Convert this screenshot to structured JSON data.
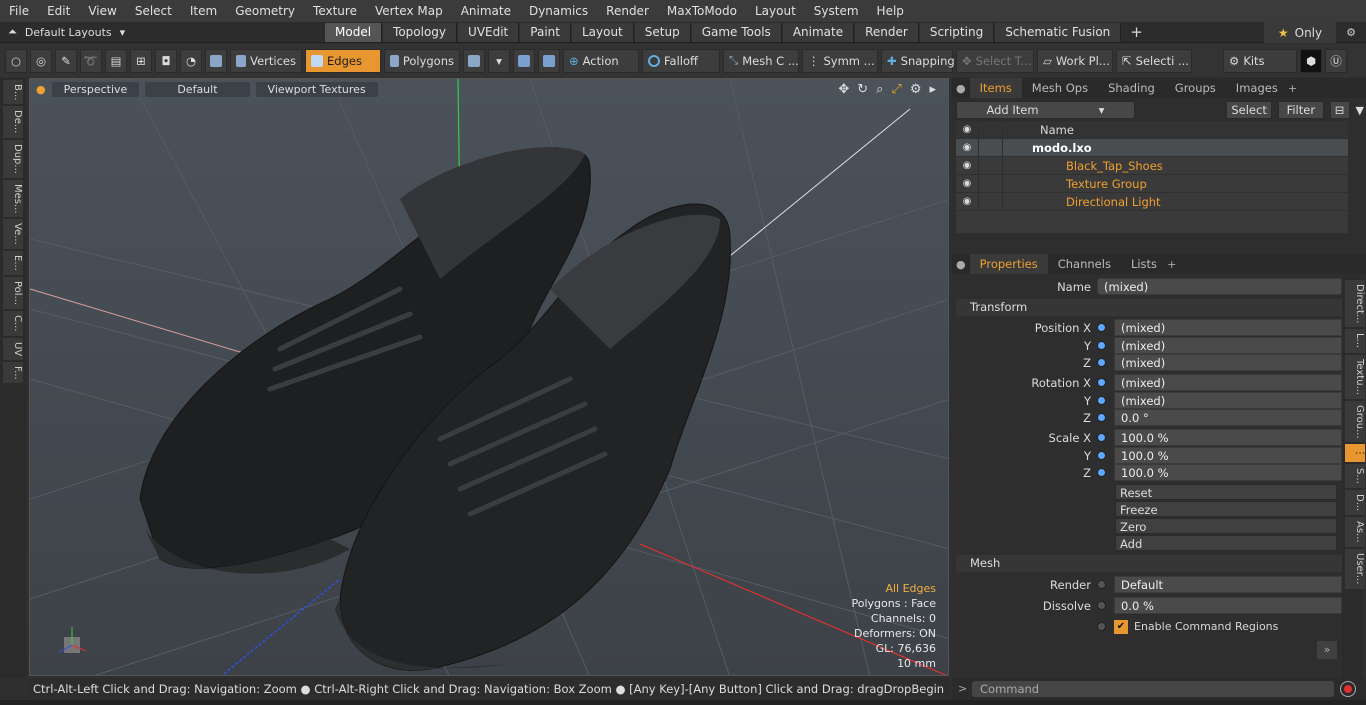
{
  "menu": [
    "File",
    "Edit",
    "View",
    "Select",
    "Item",
    "Geometry",
    "Texture",
    "Vertex Map",
    "Animate",
    "Dynamics",
    "Render",
    "MaxToModo",
    "Layout",
    "System",
    "Help"
  ],
  "layout_dropdown": "Default Layouts",
  "tabs": [
    "Model",
    "Topology",
    "UVEdit",
    "Paint",
    "Layout",
    "Setup",
    "Game Tools",
    "Animate",
    "Render",
    "Scripting",
    "Schematic Fusion"
  ],
  "active_tab": "Model",
  "only_label": "Only",
  "toolbar": {
    "vertices": "Vertices",
    "edges": "Edges",
    "polygons": "Polygons",
    "action": "Action",
    "falloff": "Falloff",
    "mesh": "Mesh C ...",
    "symm": "Symm ...",
    "snapping": "Snapping",
    "select_t": "Select T...",
    "work_pl": "Work Pl...",
    "selecti": "Selecti ...",
    "kits": "Kits"
  },
  "left_tabs": [
    "B...",
    "De...",
    "Dup...",
    "Mes...",
    "Ve...",
    "E...",
    "Pol...",
    "C...",
    "UV",
    "F..."
  ],
  "viewport": {
    "view_mode": "Perspective",
    "shading": "Default",
    "textures": "Viewport Textures",
    "stats": {
      "mode": "All Edges",
      "polygons": "Polygons : Face",
      "channels": "Channels: 0",
      "deformers": "Deformers: ON",
      "gl": "GL: 76,636",
      "size": "10 mm"
    }
  },
  "status": "Ctrl-Alt-Left Click and Drag: Navigation: Zoom ● Ctrl-Alt-Right Click and Drag: Navigation: Box Zoom ● [Any Key]-[Any Button] Click and Drag: dragDropBegin",
  "items_panel": {
    "tabs": [
      "Items",
      "Mesh Ops",
      "Shading",
      "Groups",
      "Images"
    ],
    "add_item": "Add Item",
    "select": "Select",
    "filter": "Filter",
    "col_name": "Name",
    "rows": [
      "modo.lxo",
      "Black_Tap_Shoes",
      "Texture Group",
      "Directional Light"
    ]
  },
  "properties": {
    "tabs": [
      "Properties",
      "Channels",
      "Lists"
    ],
    "name_label": "Name",
    "name_value": "(mixed)",
    "transform": "Transform",
    "position": [
      "(mixed)",
      "(mixed)",
      "(mixed)"
    ],
    "rotation": [
      "(mixed)",
      "(mixed)",
      "0.0 °"
    ],
    "scale": [
      "100.0 %",
      "100.0 %",
      "100.0 %"
    ],
    "labels": {
      "px": "Position X",
      "py": "Y",
      "pz": "Z",
      "rx": "Rotation X",
      "ry": "Y",
      "rz": "Z",
      "sx": "Scale X",
      "sy": "Y",
      "sz": "Z"
    },
    "actions": [
      "Reset",
      "Freeze",
      "Zero",
      "Add"
    ],
    "mesh": "Mesh",
    "render_label": "Render",
    "render_value": "Default",
    "dissolve_label": "Dissolve",
    "dissolve_value": "0.0 %",
    "enable_cmd": "Enable Command Regions"
  },
  "right_tabs": [
    "Direct...",
    "L...",
    "Textu...",
    "Grou...",
    "S...",
    "D...",
    "As...",
    "User..."
  ],
  "command_placeholder": "Command"
}
